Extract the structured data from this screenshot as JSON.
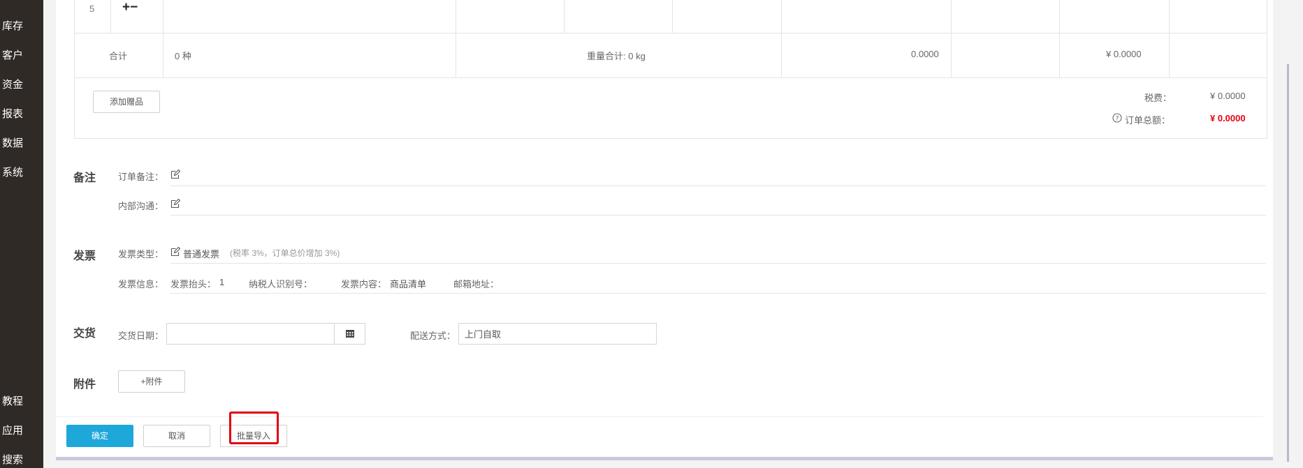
{
  "sidebar": {
    "items": [
      "库存",
      "客户",
      "资金",
      "报表",
      "数据",
      "系统"
    ],
    "bottom_items": [
      "教程",
      "应用",
      "搜索"
    ]
  },
  "table": {
    "row": {
      "index": "5",
      "actions": "+−"
    },
    "summary": {
      "label": "合计",
      "kinds": "0 种",
      "weight": "重量合计: 0 kg",
      "amount": "0.0000",
      "total": "¥ 0.0000"
    }
  },
  "gift": {
    "add_button": "添加赠品",
    "tax_label": "税费：",
    "tax_value": "¥ 0.0000",
    "order_total_label": "订单总额：",
    "order_total_value": "¥ 0.0000"
  },
  "remarks": {
    "title": "备注",
    "order_note_label": "订单备注：",
    "internal_label": "内部沟通："
  },
  "invoice": {
    "title": "发票",
    "type_label": "发票类型：",
    "type_value": "普通发票",
    "type_note": "(税率 3%，订单总价增加 3%)",
    "info_label": "发票信息：",
    "header_label": "发票抬头：",
    "header_value": "1",
    "taxpayer_label": "纳税人识别号：",
    "content_label": "发票内容：",
    "content_value": "商品清单",
    "email_label": "邮箱地址："
  },
  "delivery": {
    "title": "交货",
    "date_label": "交货日期：",
    "date_value": "",
    "method_label": "配送方式：",
    "method_value": "上门自取"
  },
  "attachment": {
    "title": "附件",
    "add_button": "+附件"
  },
  "footer": {
    "confirm": "确定",
    "cancel": "取消",
    "batch_import": "批量导入"
  },
  "colors": {
    "primary": "#1ea7d9",
    "danger": "#e60012",
    "highlight": "#e3000f",
    "sidebar": "#2f2a26"
  }
}
